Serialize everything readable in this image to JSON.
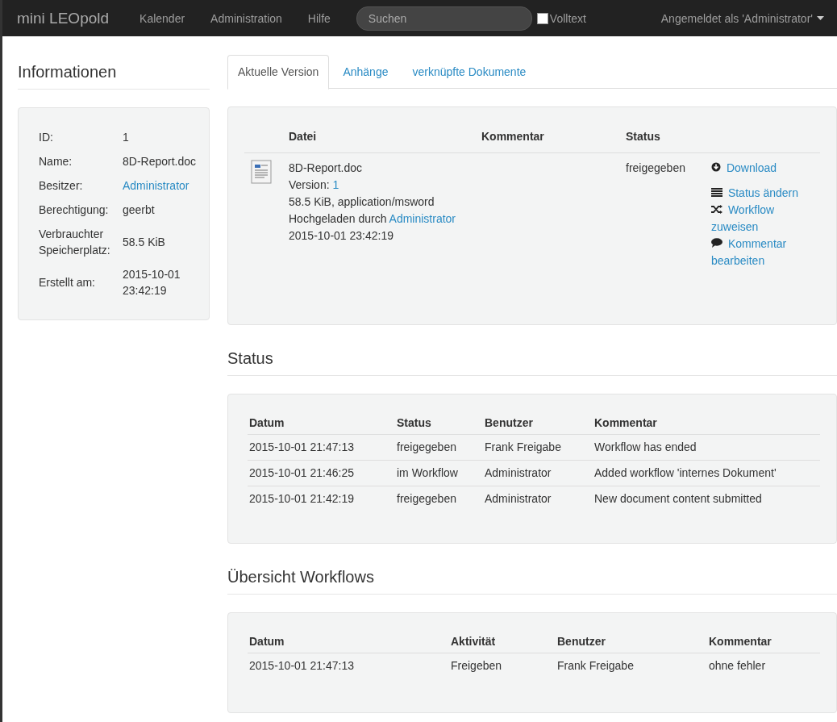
{
  "navbar": {
    "brand": "mini LEOpold",
    "links": [
      "Kalender",
      "Administration",
      "Hilfe"
    ],
    "search": {
      "placeholder": "Suchen"
    },
    "fulltext": {
      "label": "Volltext",
      "checked": false
    },
    "user": "Angemeldet als 'Administrator'"
  },
  "info": {
    "title": "Informationen",
    "rows": [
      {
        "label": "ID:",
        "value": "1",
        "kind": "text"
      },
      {
        "label": "Name:",
        "value": "8D-Report.doc",
        "kind": "text"
      },
      {
        "label": "Besitzer:",
        "value": "Administrator",
        "kind": "link"
      },
      {
        "label": "Berechtigung:",
        "value": "geerbt",
        "kind": "text"
      },
      {
        "label": "Verbrauchter Speicherplatz:",
        "value": "58.5 KiB",
        "kind": "text"
      },
      {
        "label": "Erstellt am:",
        "value": "2015-10-01 23:42:19",
        "kind": "text"
      }
    ]
  },
  "tabs": [
    {
      "label": "Aktuelle Version",
      "selected": true
    },
    {
      "label": "Anhänge",
      "selected": false
    },
    {
      "label": "verknüpfte Dokumente",
      "selected": false
    }
  ],
  "version": {
    "columns": [
      "Datei",
      "Kommentar",
      "Status"
    ],
    "file": {
      "name": "8D-Report.doc",
      "version_label": "Version: ",
      "version": "1",
      "size": "58.5 KiB, application/msword",
      "uploaded_label": "Hochgeladen durch ",
      "uploaded_by": "Administrator",
      "date": "2015-10-01 23:42:19",
      "status": "freigegeben"
    },
    "actions": [
      {
        "label": "Download",
        "kind": "download"
      },
      {
        "label": "Status ändern",
        "kind": "status"
      },
      {
        "label": "Workflow zuweisen",
        "kind": "workflow"
      },
      {
        "label": "Kommentar bearbeiten",
        "kind": "comment"
      }
    ]
  },
  "status": {
    "title": "Status",
    "columns": [
      "Datum",
      "Status",
      "Benutzer",
      "Kommentar"
    ],
    "rows": [
      [
        "2015-10-01 21:47:13",
        "freigegeben",
        "Frank Freigabe",
        "Workflow has ended"
      ],
      [
        "2015-10-01 21:46:25",
        "im Workflow",
        "Administrator",
        "Added workflow 'internes Dokument'"
      ],
      [
        "2015-10-01 21:42:19",
        "freigegeben",
        "Administrator",
        "New document content submitted"
      ]
    ]
  },
  "workflows": {
    "title": "Übersicht Workflows",
    "columns": [
      "Datum",
      "Aktivität",
      "Benutzer",
      "Kommentar"
    ],
    "rows": [
      [
        "2015-10-01 21:47:13",
        "Freigeben",
        "Frank Freigabe",
        "ohne fehler"
      ]
    ]
  }
}
